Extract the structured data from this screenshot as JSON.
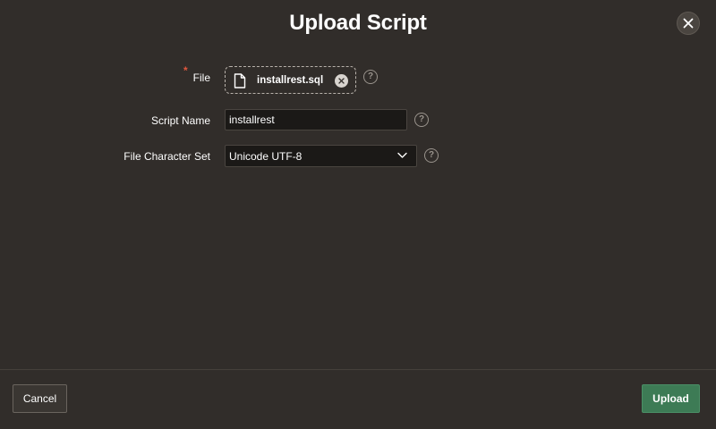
{
  "dialog": {
    "title": "Upload Script"
  },
  "form": {
    "file": {
      "label": "File",
      "required_marker": "*",
      "filename": "installrest.sql",
      "help": "?"
    },
    "script_name": {
      "label": "Script Name",
      "value": "installrest",
      "help": "?"
    },
    "charset": {
      "label": "File Character Set",
      "selected": "Unicode UTF-8",
      "help": "?"
    }
  },
  "footer": {
    "cancel_label": "Cancel",
    "upload_label": "Upload"
  },
  "colors": {
    "background": "#312d2a",
    "input_bg": "#1b1917",
    "required": "#e0573e",
    "primary_button": "#3d7b55"
  }
}
